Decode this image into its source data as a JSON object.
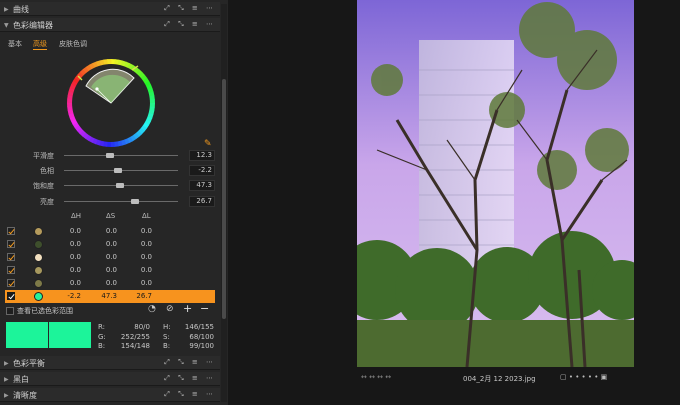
{
  "sections": {
    "curves": "曲线",
    "color_editor": "色彩编辑器",
    "color_balance": "色彩平衡",
    "bw": "黑白",
    "clarity": "清晰度"
  },
  "tools_glyph": "⤢ ⤡ ≡ ⋯",
  "tabs": [
    "基本",
    "高级",
    "皮肤色调"
  ],
  "active_tab_index": 1,
  "sliders": [
    {
      "label": "平滑度",
      "value": "12.3",
      "pos": 0.4
    },
    {
      "label": "色相",
      "value": "-2.2",
      "pos": 0.47
    },
    {
      "label": "饱和度",
      "value": "47.3",
      "pos": 0.49
    },
    {
      "label": "亮度",
      "value": "26.7",
      "pos": 0.62
    }
  ],
  "table": {
    "headers": [
      "ΔH",
      "ΔS",
      "ΔL"
    ],
    "rows": [
      {
        "color": "#b59b5c",
        "dh": "0.0",
        "ds": "0.0",
        "dl": "0.0"
      },
      {
        "color": "#3e4f2c",
        "dh": "0.0",
        "ds": "0.0",
        "dl": "0.0"
      },
      {
        "color": "#f2dfbf",
        "dh": "0.0",
        "ds": "0.0",
        "dl": "0.0"
      },
      {
        "color": "#a6985e",
        "dh": "0.0",
        "ds": "0.0",
        "dl": "0.0"
      },
      {
        "color": "#7e7a48",
        "dh": "0.0",
        "ds": "0.0",
        "dl": "0.0"
      },
      {
        "color": "#27f29b",
        "dh": "-2.2",
        "ds": "47.3",
        "dl": "26.7",
        "selected": true
      }
    ]
  },
  "view_range_label": "查看已选色彩范围",
  "readout": {
    "r": "R:",
    "r_val": "80/0",
    "g": "G:",
    "g_val": "252/255",
    "b": "B:",
    "b_val": "154/148",
    "h": "H:",
    "h_val": "146/155",
    "s": "S:",
    "s_val": "68/100",
    "bb": "B:",
    "bb_val": "99/100"
  },
  "swatch_color": "#1cf49a",
  "filename": "004_2月 12 2023.jpg",
  "nav_left": "↔  ↔  ↔  ↔",
  "nav_right": "▢  •  •  •  •  •  ▣"
}
